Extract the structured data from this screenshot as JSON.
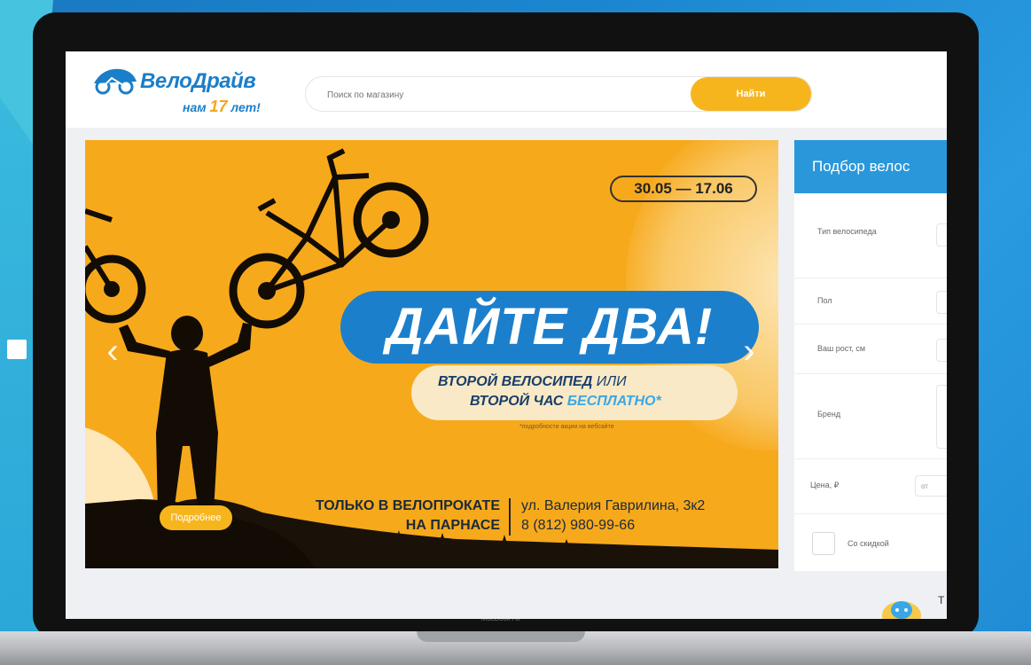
{
  "brand": {
    "name": "ВелоДрайв",
    "tagline_pre": "нам",
    "tagline_num": "17",
    "tagline_post": "лет!"
  },
  "search": {
    "placeholder": "Поиск по магазину",
    "button_label": "Найти"
  },
  "banner": {
    "date_range": "30.05 — 17.06",
    "headline": "ДАЙТЕ ДВА!",
    "sub_line1_a": "ВТОРОЙ ВЕЛОСИПЕД",
    "sub_line1_b": "ИЛИ",
    "sub_line2_a": "ВТОРОЙ ЧАС",
    "sub_line2_b": "БЕСПЛАТНО*",
    "footnote": "*подробности акции на вебсайте",
    "promo_line1": "ТОЛЬКО В ВЕЛОПРОКАТЕ",
    "promo_line2": "НА ПАРНАСЕ",
    "address": "ул. Валерия Гаврилина, 3к2",
    "phone": "8 (812) 980-99-66",
    "more_button": "Подробнее",
    "prev_arrow": "‹",
    "next_arrow": "›"
  },
  "filter": {
    "title": "Подбор велос",
    "type_label": "Тип велосипеда",
    "gender_label": "Пол",
    "height_label": "Ваш рост, см",
    "brand_label": "Бренд",
    "price_label": "Цена, ₽",
    "price_from": "от",
    "sale_label": "Со скидкой"
  },
  "device": {
    "label": "MacBook Air"
  },
  "colors": {
    "accent_blue": "#1b7ec8",
    "accent_yellow": "#f7b51d",
    "banner_orange": "#f7a91c"
  }
}
